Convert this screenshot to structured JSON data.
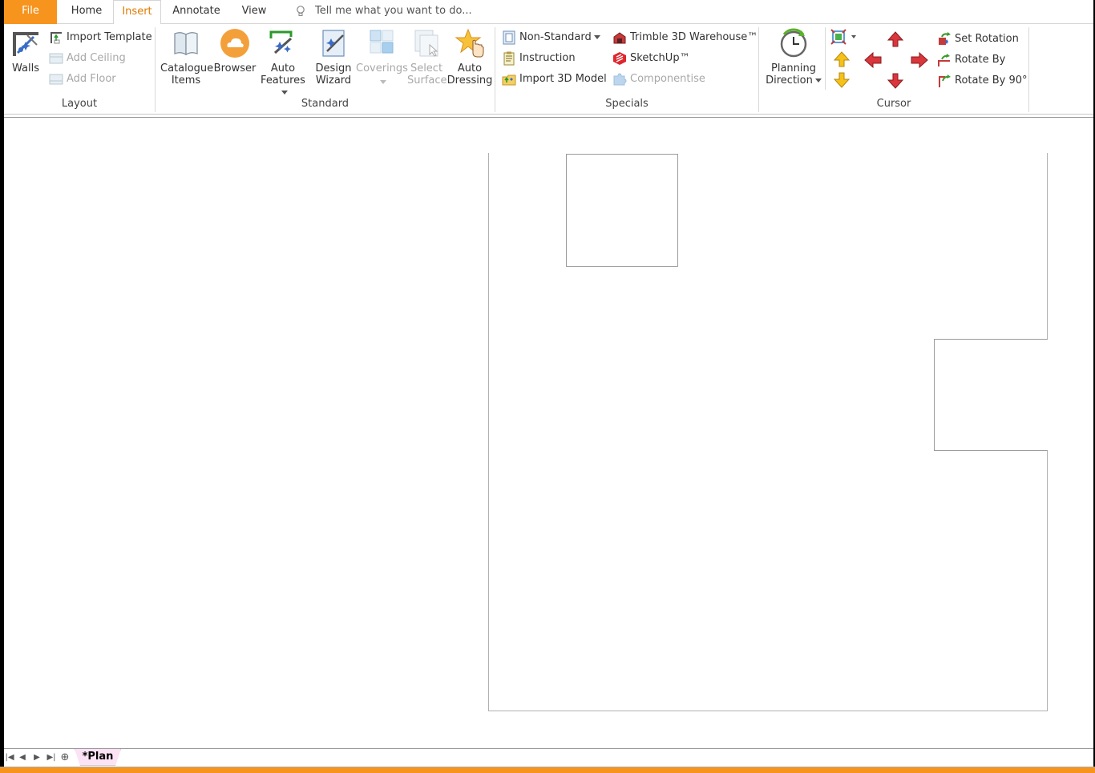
{
  "tabs": {
    "file": "File",
    "home": "Home",
    "insert": "Insert",
    "annotate": "Annotate",
    "view": "View",
    "tellme_placeholder": "Tell me what you want to do..."
  },
  "layout_group": {
    "label": "Layout",
    "walls": "Walls",
    "import_template": "Import Template",
    "add_ceiling": "Add Ceiling",
    "add_floor": "Add Floor"
  },
  "standard_group": {
    "label": "Standard",
    "catalogue_items_1": "Catalogue",
    "catalogue_items_2": "Items",
    "browser": "Browser",
    "auto_features_1": "Auto",
    "auto_features_2": "Features",
    "design_wizard_1": "Design",
    "design_wizard_2": "Wizard",
    "coverings": "Coverings",
    "select_surface_1": "Select",
    "select_surface_2": "Surface",
    "auto_dressing_1": "Auto",
    "auto_dressing_2": "Dressing"
  },
  "specials_group": {
    "label": "Specials",
    "non_standard": "Non-Standard",
    "instruction": "Instruction",
    "import_3d_model": "Import 3D Model",
    "trimble_warehouse": "Trimble 3D Warehouse™",
    "sketchup": "SketchUp™",
    "componentise": "Componentise"
  },
  "cursor_group": {
    "label": "Cursor",
    "planning_direction_1": "Planning",
    "planning_direction_2": "Direction",
    "set_rotation": "Set Rotation",
    "rotate_by": "Rotate By",
    "rotate_by_90": "Rotate By 90°"
  },
  "sheet": {
    "tab_label": "*Plan"
  },
  "colors": {
    "file_tab": "#f7941d",
    "active_tab_text": "#e07b00",
    "sheet_tab": "#fbe3f5"
  }
}
